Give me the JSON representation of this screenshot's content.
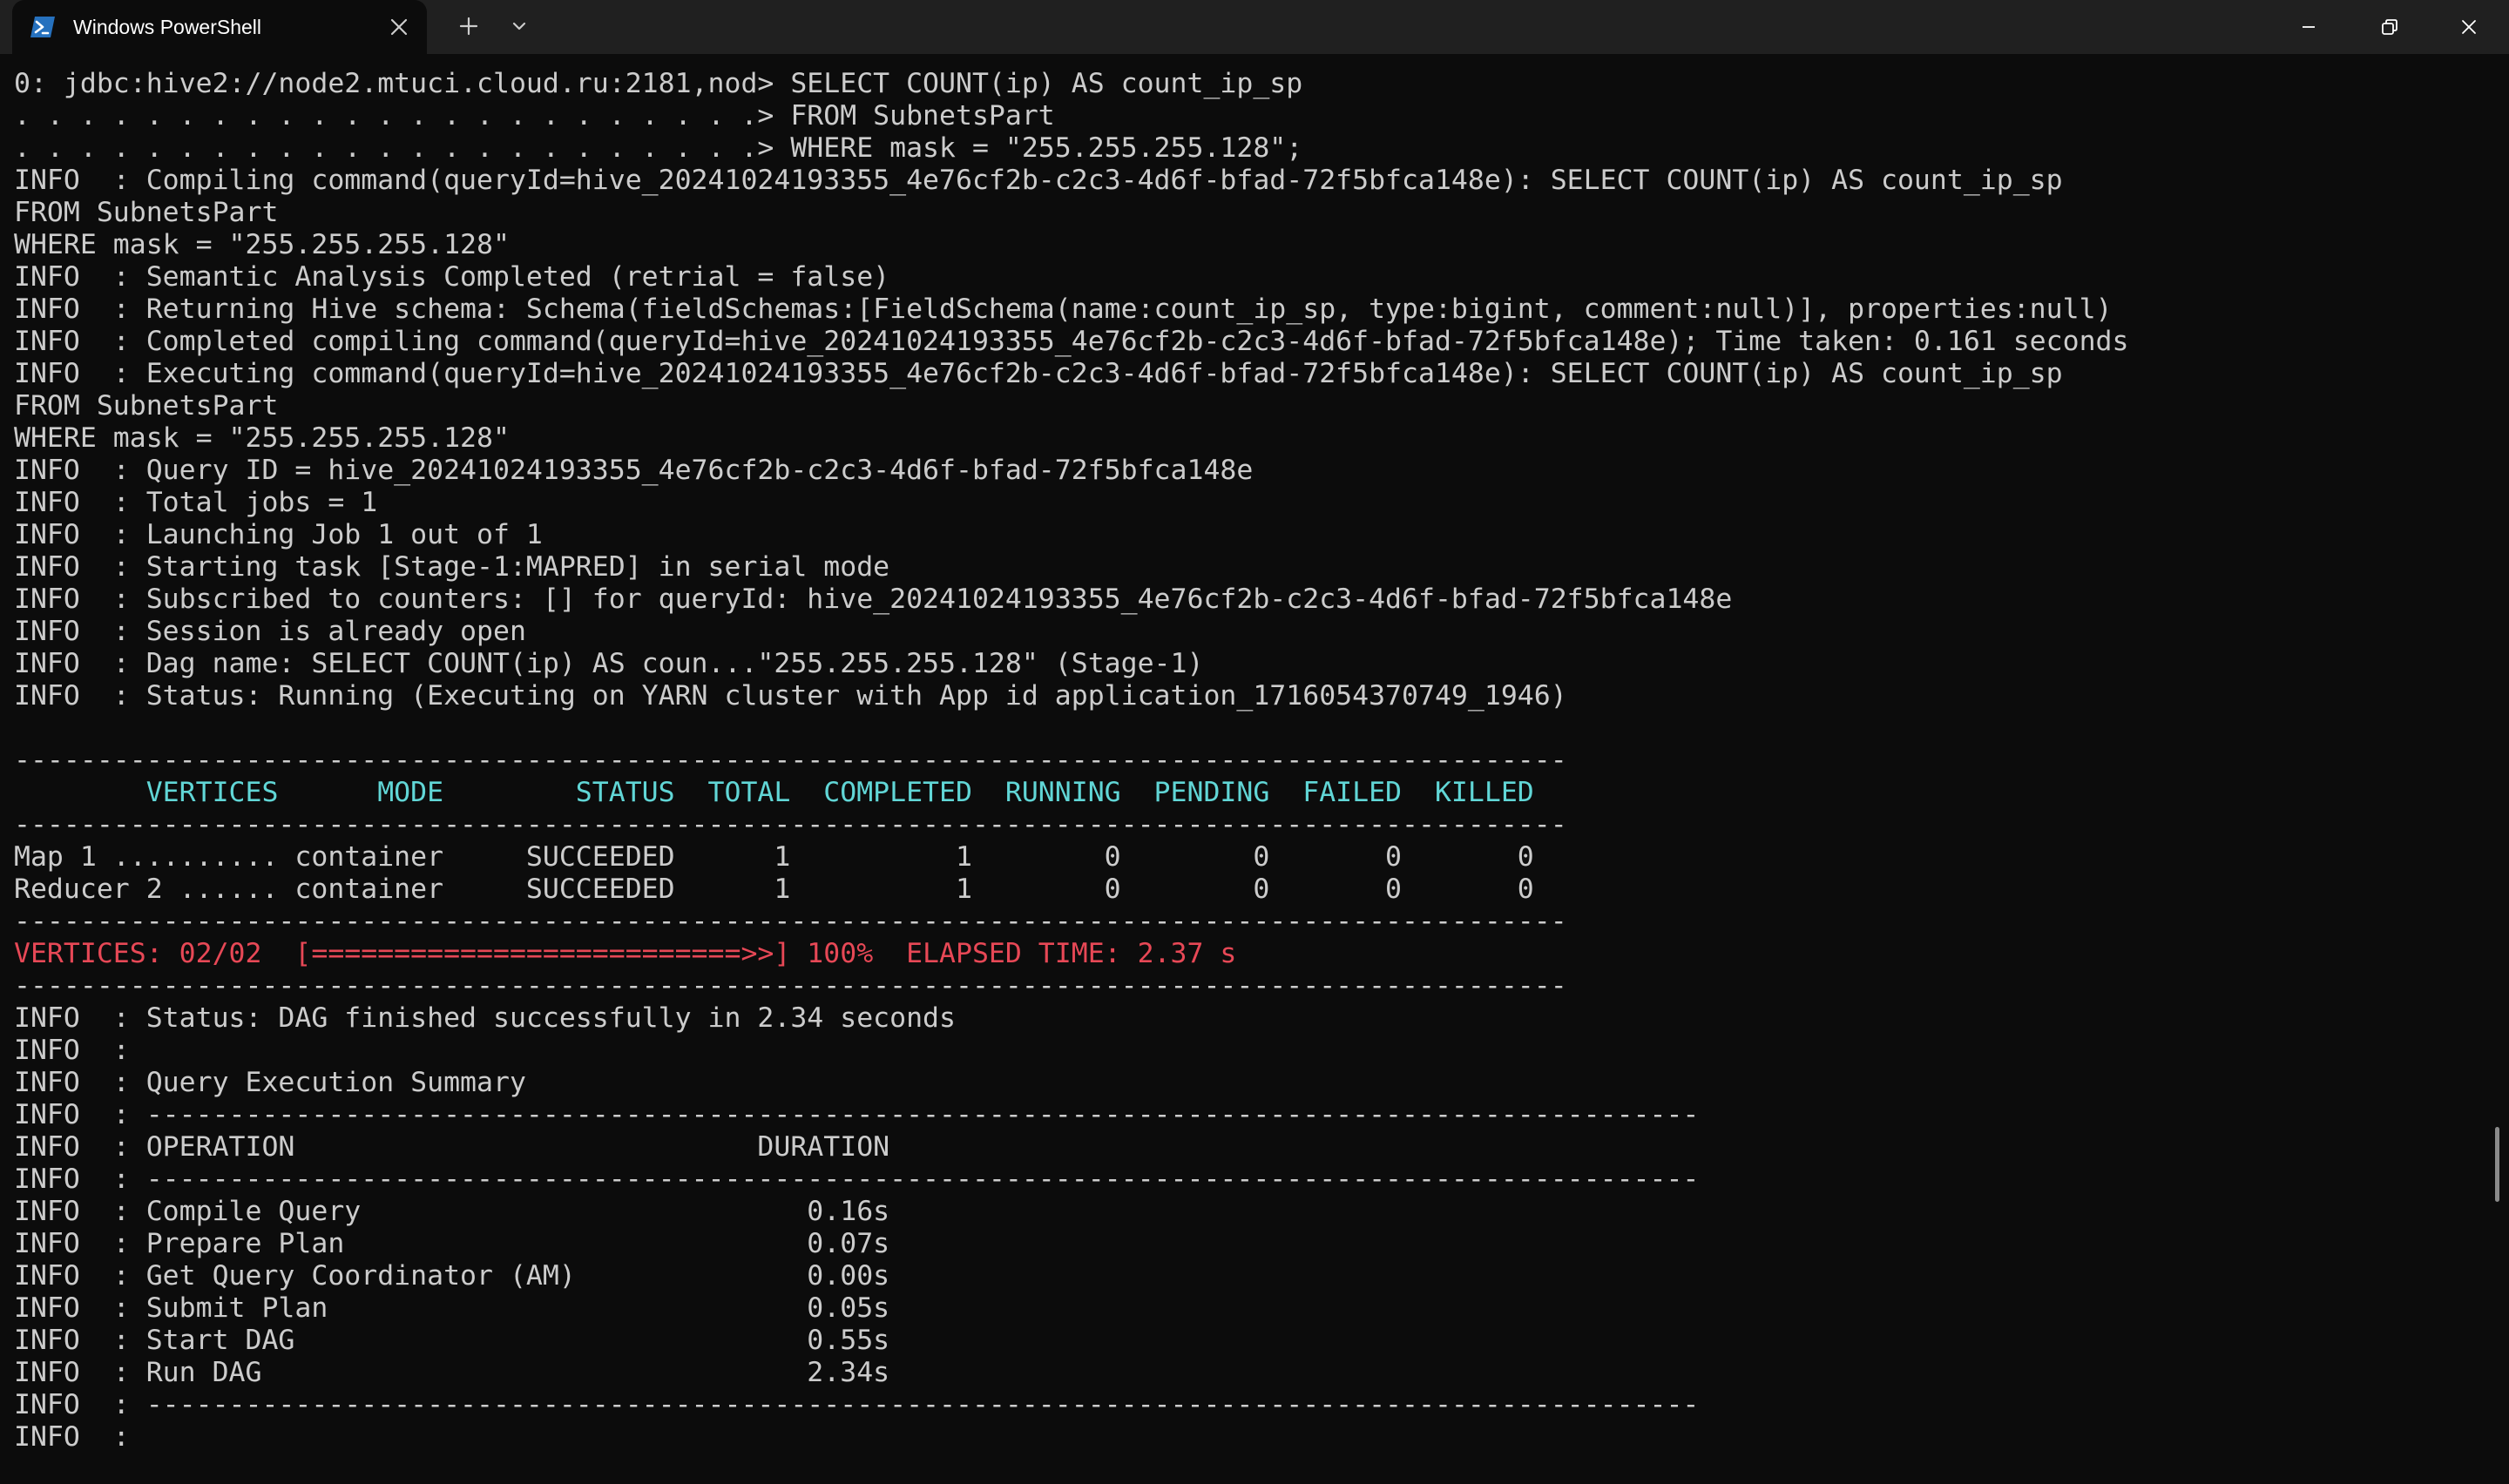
{
  "window": {
    "tab_title": "Windows PowerShell",
    "icons": {
      "tab": "powershell-icon",
      "close_tab": "close-icon",
      "new_tab": "plus-icon",
      "dropdown": "chevron-down-icon",
      "minimize": "minimize-icon",
      "maximize": "restore-icon",
      "close": "close-icon"
    }
  },
  "colors": {
    "background": "#0c0c0c",
    "titlebar": "#202020",
    "text": "#cccccc",
    "cyan": "#61d6d6",
    "red": "#e74856",
    "powershell_blue": "#2671be"
  },
  "terminal": {
    "lines": [
      "0: jdbc:hive2://node2.mtuci.cloud.ru:2181,nod> SELECT COUNT(ip) AS count_ip_sp",
      ". . . . . . . . . . . . . . . . . . . . . . .> FROM SubnetsPart",
      ". . . . . . . . . . . . . . . . . . . . . . .> WHERE mask = \"255.255.255.128\";",
      "INFO  : Compiling command(queryId=hive_20241024193355_4e76cf2b-c2c3-4d6f-bfad-72f5bfca148e): SELECT COUNT(ip) AS count_ip_sp",
      "FROM SubnetsPart",
      "WHERE mask = \"255.255.255.128\"",
      "INFO  : Semantic Analysis Completed (retrial = false)",
      "INFO  : Returning Hive schema: Schema(fieldSchemas:[FieldSchema(name:count_ip_sp, type:bigint, comment:null)], properties:null)",
      "INFO  : Completed compiling command(queryId=hive_20241024193355_4e76cf2b-c2c3-4d6f-bfad-72f5bfca148e); Time taken: 0.161 seconds",
      "INFO  : Executing command(queryId=hive_20241024193355_4e76cf2b-c2c3-4d6f-bfad-72f5bfca148e): SELECT COUNT(ip) AS count_ip_sp",
      "FROM SubnetsPart",
      "WHERE mask = \"255.255.255.128\"",
      "INFO  : Query ID = hive_20241024193355_4e76cf2b-c2c3-4d6f-bfad-72f5bfca148e",
      "INFO  : Total jobs = 1",
      "INFO  : Launching Job 1 out of 1",
      "INFO  : Starting task [Stage-1:MAPRED] in serial mode",
      "INFO  : Subscribed to counters: [] for queryId: hive_20241024193355_4e76cf2b-c2c3-4d6f-bfad-72f5bfca148e",
      "INFO  : Session is already open",
      "INFO  : Dag name: SELECT COUNT(ip) AS coun...\"255.255.255.128\" (Stage-1)",
      "INFO  : Status: Running (Executing on YARN cluster with App id application_1716054370749_1946)",
      "",
      "----------------------------------------------------------------------------------------------",
      "        VERTICES      MODE        STATUS  TOTAL  COMPLETED  RUNNING  PENDING  FAILED  KILLED",
      "----------------------------------------------------------------------------------------------",
      "Map 1 .......... container     SUCCEEDED      1          1        0        0       0       0",
      "Reducer 2 ...... container     SUCCEEDED      1          1        0        0       0       0",
      "----------------------------------------------------------------------------------------------",
      "VERTICES: 02/02  [==========================>>] 100%  ELAPSED TIME: 2.37 s",
      "----------------------------------------------------------------------------------------------",
      "INFO  : Status: DAG finished successfully in 2.34 seconds",
      "INFO  :",
      "INFO  : Query Execution Summary",
      "INFO  : ----------------------------------------------------------------------------------------------",
      "INFO  : OPERATION                            DURATION",
      "INFO  : ----------------------------------------------------------------------------------------------",
      "INFO  : Compile Query                           0.16s",
      "INFO  : Prepare Plan                            0.07s",
      "INFO  : Get Query Coordinator (AM)              0.00s",
      "INFO  : Submit Plan                             0.05s",
      "INFO  : Start DAG                               0.55s",
      "INFO  : Run DAG                                 2.34s",
      "INFO  : ----------------------------------------------------------------------------------------------",
      "INFO  :"
    ],
    "cyan_lines": [
      22
    ],
    "red_lines": [
      27
    ]
  }
}
